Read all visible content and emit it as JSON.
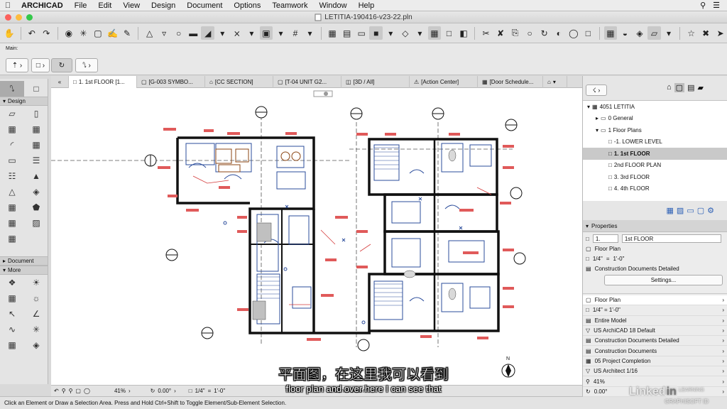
{
  "menubar": {
    "app_name": "ARCHICAD",
    "items": [
      "File",
      "Edit",
      "View",
      "Design",
      "Document",
      "Options",
      "Teamwork",
      "Window",
      "Help"
    ]
  },
  "window": {
    "title": "LETITIA-190416-v23-22.pln"
  },
  "infobox": {
    "label": "Main:"
  },
  "toolbox": {
    "sections": [
      "Design",
      "Document",
      "More"
    ]
  },
  "tabs": [
    {
      "label": "1. 1st FLOOR [1...",
      "icon": "floor-plan-icon"
    },
    {
      "label": "[G-003 SYMBO...",
      "icon": "layout-icon"
    },
    {
      "label": "[CC SECTION]",
      "icon": "section-icon"
    },
    {
      "label": "[T-04 UNIT G2...",
      "icon": "layout-icon"
    },
    {
      "label": "[3D / All]",
      "icon": "3d-icon"
    },
    {
      "label": "[Action Center]",
      "icon": "action-center-icon"
    },
    {
      "label": "[Door Schedule...",
      "icon": "schedule-icon"
    }
  ],
  "navigator": {
    "project": "4051 LETITIA",
    "items": [
      {
        "label": "0 General",
        "level": 1,
        "selected": false
      },
      {
        "label": "1 Floor Plans",
        "level": 1,
        "selected": false
      },
      {
        "label": "-1. LOWER LEVEL",
        "level": 2,
        "selected": false
      },
      {
        "label": "1. 1st FLOOR",
        "level": 2,
        "selected": true
      },
      {
        "label": "2nd FLOOR PLAN",
        "level": 2,
        "selected": false
      },
      {
        "label": "3. 3rd FLOOR",
        "level": 2,
        "selected": false
      },
      {
        "label": "4. 4th FLOOR",
        "level": 2,
        "selected": false
      }
    ]
  },
  "properties": {
    "header": "Properties",
    "id_value": "1.",
    "name_value": "1st FLOOR",
    "type": "Floor Plan",
    "scale": "1/4\"",
    "scale_eq": "=",
    "scale_value": "1'-0\"",
    "model_view": "Construction Documents Detailed",
    "settings_label": "Settings...",
    "details": [
      {
        "label": "Floor Plan",
        "icon": "floor-plan-icon"
      },
      {
        "label": "1/4\"    =    1'-0\"",
        "icon": "scale-icon"
      },
      {
        "label": "Entire Model",
        "icon": "model-icon"
      },
      {
        "label": "US ArchiCAD 18 Default",
        "icon": "layer-icon"
      },
      {
        "label": "Construction Documents Detailed",
        "icon": "mvo-icon"
      },
      {
        "label": "Construction Documents",
        "icon": "pen-set-icon"
      },
      {
        "label": "05 Project Completion",
        "icon": "renovation-icon"
      },
      {
        "label": "US Architect 1/16",
        "icon": "dimension-icon"
      },
      {
        "label": "41%",
        "icon": "zoom-icon"
      },
      {
        "label": "0.00°",
        "icon": "rotation-icon"
      }
    ]
  },
  "statusbar": {
    "zoom": "41%",
    "angle": "0.00°",
    "scale": "1/4\"",
    "scale_eq": "=",
    "scale_value": "1'-0\"",
    "model_view": "Construction..."
  },
  "hint": "Click an Element or Draw a Selection Area. Press and Hold Ctrl+Shift to Toggle Element/Sub-Element Selection.",
  "subtitles": {
    "chinese": "平面图，在这里我可以看到",
    "english": "floor plan and over here I can see that"
  },
  "watermark": {
    "brand_left": "Linked",
    "brand_right": "in",
    "learning": "LEARNING",
    "partner": "GRAPHISOFT ID"
  },
  "plan": {
    "north_label": "N"
  }
}
